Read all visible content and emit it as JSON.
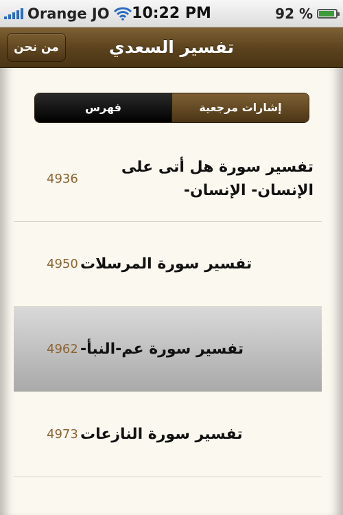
{
  "status_bar": {
    "carrier": "Orange JO",
    "time": "10:22 PM",
    "battery_percent": "92 %",
    "battery_level": 0.92
  },
  "navbar": {
    "title": "تفسير السعدي",
    "left_button": "من نحن"
  },
  "segmented": {
    "left": "فهرس",
    "right": "إشارات مرجعية",
    "selected": "left"
  },
  "list": {
    "items": [
      {
        "title": "تفسير سورة هل أتى على الإنسان- الإنسان-",
        "page": "4936",
        "selected": false
      },
      {
        "title": "تفسير سورة المرسلات",
        "page": "4950",
        "selected": false
      },
      {
        "title": "تفسير سورة عم-النبأ-",
        "page": "4962",
        "selected": true
      },
      {
        "title": "تفسير سورة النازعات",
        "page": "4973",
        "selected": false
      }
    ]
  },
  "colors": {
    "nav_brown": "#5a411c",
    "page_number": "#8d6331",
    "content_bg": "#faf8ef"
  }
}
